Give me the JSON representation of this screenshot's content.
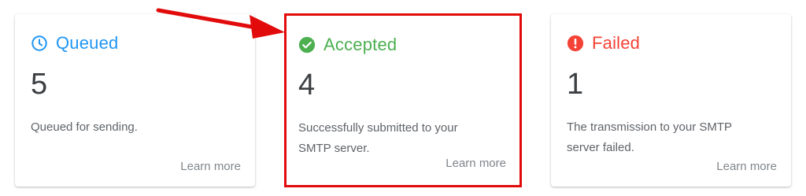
{
  "cards": [
    {
      "key": "queued",
      "title": "Queued",
      "icon": "clock-icon",
      "color": "#2196f3",
      "count": "5",
      "description": "Queued for sending.",
      "link": "Learn more"
    },
    {
      "key": "accepted",
      "title": "Accepted",
      "icon": "check-circle-icon",
      "color": "#4caf50",
      "count": "4",
      "description": "Successfully submitted to your SMTP server.",
      "link": "Learn more"
    },
    {
      "key": "failed",
      "title": "Failed",
      "icon": "alert-circle-icon",
      "color": "#f44336",
      "count": "1",
      "description": "The transmission to your SMTP server failed.",
      "link": "Learn more"
    }
  ],
  "annotation": {
    "highlight_color": "#e20b0b",
    "arrow_color": "#e20b0b"
  }
}
